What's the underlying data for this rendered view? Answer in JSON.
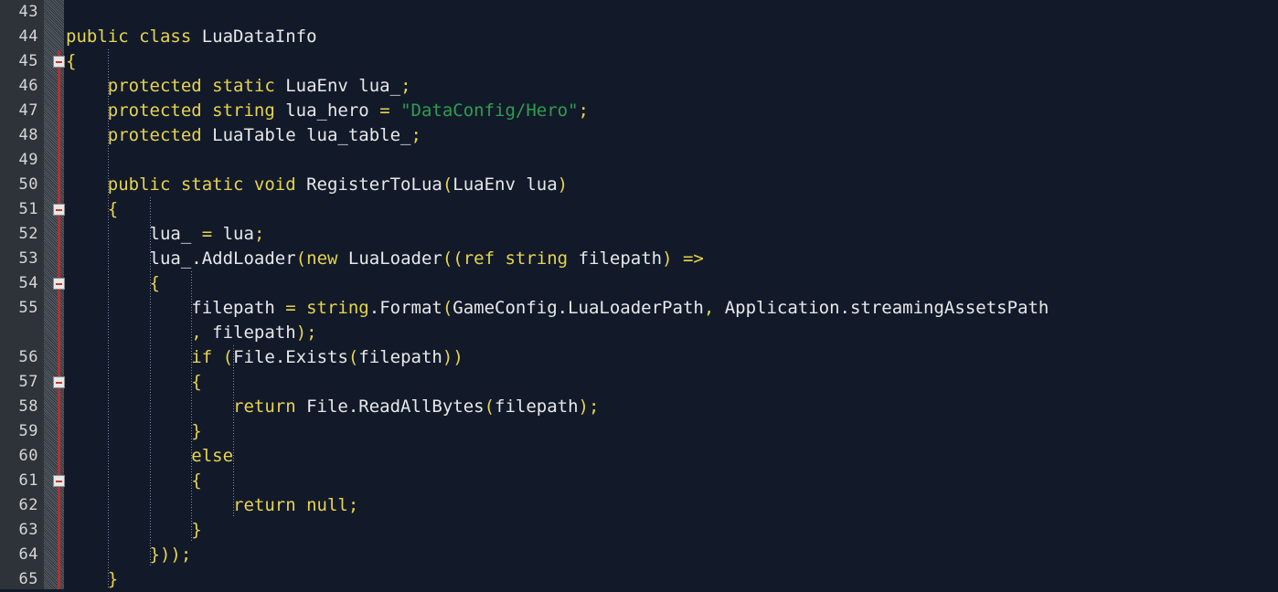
{
  "editor": {
    "name": "code-editor",
    "language": "csharp",
    "colors": {
      "background": "#121a2a",
      "gutter_background": "#2d3339",
      "line_number": "#d6d6d6",
      "change_bar": "#b62f2f",
      "keyword": "#e8d44d",
      "identifier": "#e8e8e8",
      "string": "#2e9e4f",
      "indent_guide": "#7b88a8"
    },
    "first_visible_line": 43,
    "last_visible_line": 65
  },
  "gutter": {
    "line_numbers": [
      "43",
      "44",
      "45",
      "46",
      "47",
      "48",
      "49",
      "50",
      "51",
      "52",
      "53",
      "54",
      "55",
      "",
      "56",
      "57",
      "58",
      "59",
      "60",
      "61",
      "62",
      "63",
      "64",
      "65"
    ],
    "fold_markers": [
      {
        "line": "45",
        "state": "expanded",
        "glyph": "minus"
      },
      {
        "line": "51",
        "state": "expanded",
        "glyph": "minus"
      },
      {
        "line": "54",
        "state": "expanded",
        "glyph": "minus"
      },
      {
        "line": "57",
        "state": "expanded",
        "glyph": "minus"
      },
      {
        "line": "61",
        "state": "expanded",
        "glyph": "minus"
      }
    ]
  },
  "code": {
    "lines": [
      {
        "n": "43",
        "text": "",
        "tokens": []
      },
      {
        "n": "44",
        "text": "public class LuaDataInfo",
        "tokens": [
          {
            "t": "k",
            "v": "public class "
          },
          {
            "t": "id",
            "v": "LuaDataInfo"
          }
        ]
      },
      {
        "n": "45",
        "text": "{",
        "tokens": [
          {
            "t": "p",
            "v": "{"
          }
        ]
      },
      {
        "n": "46",
        "text": "    protected static LuaEnv lua_;",
        "tokens": [
          {
            "t": "id",
            "v": "    "
          },
          {
            "t": "k",
            "v": "protected static "
          },
          {
            "t": "id",
            "v": "LuaEnv lua_"
          },
          {
            "t": "p",
            "v": ";"
          }
        ]
      },
      {
        "n": "47",
        "text": "    protected string lua_hero = \"DataConfig/Hero\";",
        "tokens": [
          {
            "t": "id",
            "v": "    "
          },
          {
            "t": "k",
            "v": "protected string "
          },
          {
            "t": "id",
            "v": "lua_hero "
          },
          {
            "t": "op",
            "v": "= "
          },
          {
            "t": "s",
            "v": "\"DataConfig/Hero\""
          },
          {
            "t": "p",
            "v": ";"
          }
        ]
      },
      {
        "n": "48",
        "text": "    protected LuaTable lua_table_;",
        "tokens": [
          {
            "t": "id",
            "v": "    "
          },
          {
            "t": "k",
            "v": "protected "
          },
          {
            "t": "id",
            "v": "LuaTable lua_table_"
          },
          {
            "t": "p",
            "v": ";"
          }
        ]
      },
      {
        "n": "49",
        "text": "",
        "tokens": []
      },
      {
        "n": "50",
        "text": "    public static void RegisterToLua(LuaEnv lua)",
        "tokens": [
          {
            "t": "id",
            "v": "    "
          },
          {
            "t": "k",
            "v": "public static void "
          },
          {
            "t": "id",
            "v": "RegisterToLua"
          },
          {
            "t": "p",
            "v": "("
          },
          {
            "t": "id",
            "v": "LuaEnv lua"
          },
          {
            "t": "p",
            "v": ")"
          }
        ]
      },
      {
        "n": "51",
        "text": "    {",
        "tokens": [
          {
            "t": "id",
            "v": "    "
          },
          {
            "t": "p",
            "v": "{"
          }
        ]
      },
      {
        "n": "52",
        "text": "        lua_ = lua;",
        "tokens": [
          {
            "t": "id",
            "v": "        lua_ "
          },
          {
            "t": "op",
            "v": "= "
          },
          {
            "t": "id",
            "v": "lua"
          },
          {
            "t": "p",
            "v": ";"
          }
        ]
      },
      {
        "n": "53",
        "text": "        lua_.AddLoader(new LuaLoader((ref string filepath) =>",
        "tokens": [
          {
            "t": "id",
            "v": "        lua_.AddLoader"
          },
          {
            "t": "p",
            "v": "("
          },
          {
            "t": "k",
            "v": "new "
          },
          {
            "t": "id",
            "v": "LuaLoader"
          },
          {
            "t": "p",
            "v": "(("
          },
          {
            "t": "k",
            "v": "ref string "
          },
          {
            "t": "id",
            "v": "filepath"
          },
          {
            "t": "p",
            "v": ") "
          },
          {
            "t": "op",
            "v": "=>"
          }
        ]
      },
      {
        "n": "54",
        "text": "        {",
        "tokens": [
          {
            "t": "id",
            "v": "        "
          },
          {
            "t": "p",
            "v": "{"
          }
        ]
      },
      {
        "n": "55",
        "text": "            filepath = string.Format(GameConfig.LuaLoaderPath, Application.streamingAssetsPath",
        "tokens": [
          {
            "t": "id",
            "v": "            filepath "
          },
          {
            "t": "op",
            "v": "= "
          },
          {
            "t": "k",
            "v": "string"
          },
          {
            "t": "id",
            "v": ".Format"
          },
          {
            "t": "p",
            "v": "("
          },
          {
            "t": "id",
            "v": "GameConfig.LuaLoaderPath"
          },
          {
            "t": "p",
            "v": ", "
          },
          {
            "t": "id",
            "v": "Application.streamingAssetsPath"
          }
        ]
      },
      {
        "n": "",
        "text": "            , filepath);",
        "wrapped": true,
        "tokens": [
          {
            "t": "id",
            "v": "            "
          },
          {
            "t": "p",
            "v": ", "
          },
          {
            "t": "id",
            "v": "filepath"
          },
          {
            "t": "p",
            "v": ");"
          }
        ]
      },
      {
        "n": "56",
        "text": "            if (File.Exists(filepath))",
        "tokens": [
          {
            "t": "id",
            "v": "            "
          },
          {
            "t": "k",
            "v": "if "
          },
          {
            "t": "p",
            "v": "("
          },
          {
            "t": "id",
            "v": "File.Exists"
          },
          {
            "t": "p",
            "v": "("
          },
          {
            "t": "id",
            "v": "filepath"
          },
          {
            "t": "p",
            "v": "))"
          }
        ]
      },
      {
        "n": "57",
        "text": "            {",
        "tokens": [
          {
            "t": "id",
            "v": "            "
          },
          {
            "t": "p",
            "v": "{"
          }
        ]
      },
      {
        "n": "58",
        "text": "                return File.ReadAllBytes(filepath);",
        "tokens": [
          {
            "t": "id",
            "v": "                "
          },
          {
            "t": "k",
            "v": "return "
          },
          {
            "t": "id",
            "v": "File.ReadAllBytes"
          },
          {
            "t": "p",
            "v": "("
          },
          {
            "t": "id",
            "v": "filepath"
          },
          {
            "t": "p",
            "v": ");"
          }
        ]
      },
      {
        "n": "59",
        "text": "            }",
        "tokens": [
          {
            "t": "id",
            "v": "            "
          },
          {
            "t": "p",
            "v": "}"
          }
        ]
      },
      {
        "n": "60",
        "text": "            else",
        "tokens": [
          {
            "t": "id",
            "v": "            "
          },
          {
            "t": "k",
            "v": "else"
          }
        ]
      },
      {
        "n": "61",
        "text": "            {",
        "tokens": [
          {
            "t": "id",
            "v": "            "
          },
          {
            "t": "p",
            "v": "{"
          }
        ]
      },
      {
        "n": "62",
        "text": "                return null;",
        "tokens": [
          {
            "t": "id",
            "v": "                "
          },
          {
            "t": "k",
            "v": "return null"
          },
          {
            "t": "p",
            "v": ";"
          }
        ]
      },
      {
        "n": "63",
        "text": "            }",
        "tokens": [
          {
            "t": "id",
            "v": "            "
          },
          {
            "t": "p",
            "v": "}"
          }
        ]
      },
      {
        "n": "64",
        "text": "        }));",
        "tokens": [
          {
            "t": "id",
            "v": "        "
          },
          {
            "t": "p",
            "v": "}));"
          }
        ]
      },
      {
        "n": "65",
        "text": "    }",
        "tokens": [
          {
            "t": "id",
            "v": "    "
          },
          {
            "t": "p",
            "v": "}"
          }
        ]
      }
    ]
  },
  "indent_guides": [
    {
      "column": 4,
      "from_row": 2,
      "to_row": 23
    },
    {
      "column": 8,
      "from_row": 8,
      "to_row": 22
    },
    {
      "column": 12,
      "from_row": 11,
      "to_row": 21
    },
    {
      "column": 16,
      "from_row": 14,
      "to_row": 20
    }
  ]
}
